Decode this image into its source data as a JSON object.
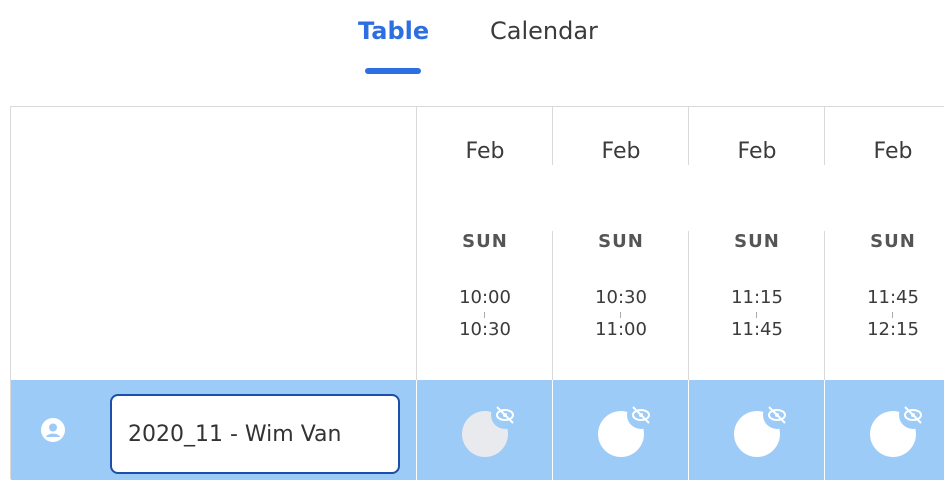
{
  "tabs": [
    {
      "label": "Table",
      "active": true
    },
    {
      "label": "Calendar",
      "active": false
    }
  ],
  "columns": [
    {
      "month": "Feb",
      "day": "SUN",
      "start": "10:00",
      "end": "10:30"
    },
    {
      "month": "Feb",
      "day": "SUN",
      "start": "10:30",
      "end": "11:00"
    },
    {
      "month": "Feb",
      "day": "SUN",
      "start": "11:15",
      "end": "11:45"
    },
    {
      "month": "Feb",
      "day": "SUN",
      "start": "11:45",
      "end": "12:15"
    }
  ],
  "row": {
    "name_value": "2020_11 - Wim Van",
    "icon": "user-circle-icon",
    "cells": [
      {
        "state": "unselected",
        "icon": "hidden-eye-icon"
      },
      {
        "state": "selected",
        "icon": "hidden-eye-icon"
      },
      {
        "state": "selected",
        "icon": "hidden-eye-icon"
      },
      {
        "state": "selected",
        "icon": "hidden-eye-icon"
      }
    ]
  },
  "colors": {
    "accent": "#2d6fe0",
    "row_background": "#9dcbf7",
    "field_border": "#1b4fa8",
    "grid_line": "#d9d9d9"
  }
}
